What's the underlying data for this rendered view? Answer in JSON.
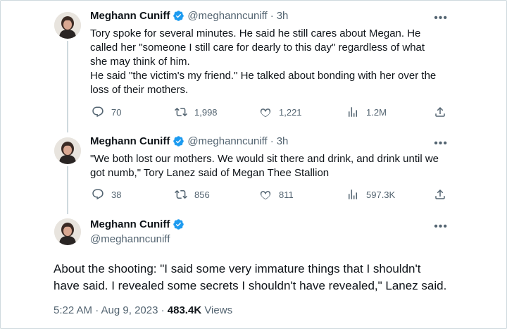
{
  "tweets": [
    {
      "author": "Meghann Cuniff",
      "handle": "@meghanncuniff",
      "separator": "·",
      "time": "3h",
      "more": "•••",
      "lines": [
        "Tory spoke for several minutes. He said he still cares about Megan. He",
        "called her \"someone I still care for dearly to this day\" regardless of what",
        "she may think of him.",
        "He said \"the victim's my friend.\" He talked about bonding with her over the",
        "loss of their mothers."
      ],
      "replies": "70",
      "retweets": "1,998",
      "likes": "1,221",
      "views": "1.2M"
    },
    {
      "author": "Meghann Cuniff",
      "handle": "@meghanncuniff",
      "separator": "·",
      "time": "3h",
      "more": "•••",
      "lines": [
        "\"We both lost our mothers. We would sit there and drink, and drink until we",
        "got numb,\" Tory Lanez said of Megan Thee Stallion"
      ],
      "replies": "38",
      "retweets": "856",
      "likes": "811",
      "views": "597.3K"
    }
  ],
  "main": {
    "author": "Meghann Cuniff",
    "handle": "@meghanncuniff",
    "more": "•••",
    "lines": [
      "About the shooting: \"I said some very immature things that I shouldn't",
      "have said. I revealed some secrets I shouldn't have revealed,\" Lanez said."
    ],
    "time": "5:22 AM · Aug 9, 2023 · ",
    "views_count": "483.4K",
    "views_label": " Views"
  },
  "colors": {
    "verified": "#1d9bf0",
    "text": "#0f1419",
    "muted": "#536471",
    "thread_line": "#cfd9de"
  },
  "icons": [
    "verified-badge-icon",
    "reply-icon",
    "retweet-icon",
    "like-icon",
    "views-icon",
    "share-icon",
    "more-icon"
  ]
}
